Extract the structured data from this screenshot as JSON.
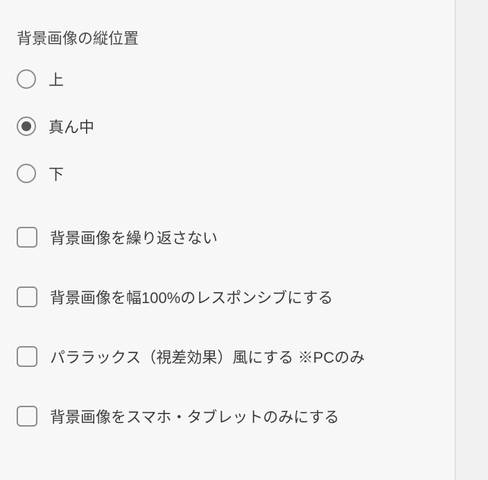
{
  "section": {
    "title": "背景画像の縦位置"
  },
  "radio": {
    "options": [
      {
        "label": "上",
        "selected": false
      },
      {
        "label": "真ん中",
        "selected": true
      },
      {
        "label": "下",
        "selected": false
      }
    ]
  },
  "checkboxes": [
    {
      "label": "背景画像を繰り返さない",
      "checked": false
    },
    {
      "label": "背景画像を幅100%のレスポンシブにする",
      "checked": false
    },
    {
      "label": "パララックス（視差効果）風にする ※PCのみ",
      "checked": false
    },
    {
      "label": "背景画像をスマホ・タブレットのみにする",
      "checked": false
    }
  ]
}
